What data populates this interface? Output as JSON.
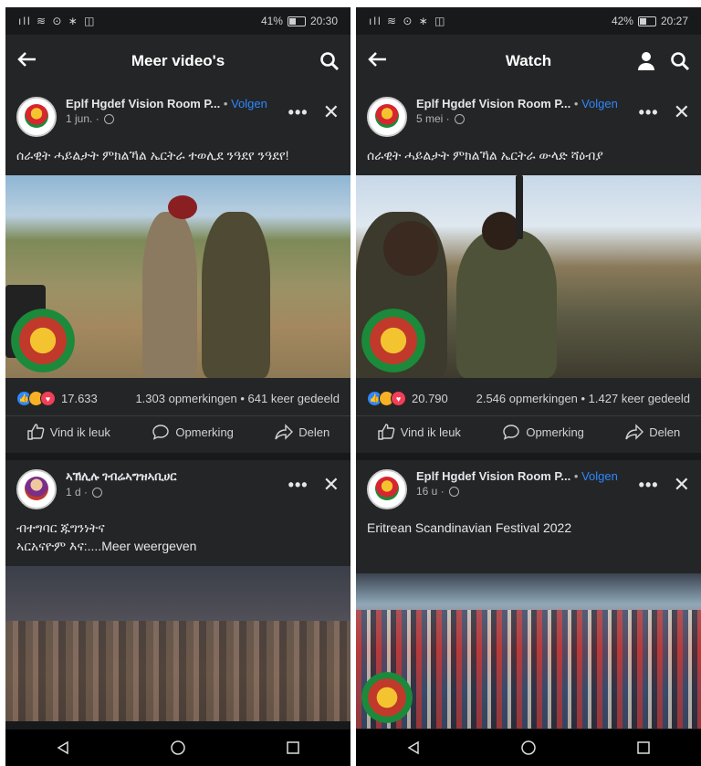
{
  "left": {
    "status": {
      "icons": "ıll ≋ ⊙ ∗ ◫",
      "battery_pct": "41%",
      "time": "20:30"
    },
    "nav": {
      "title": "Meer video's"
    },
    "posts": [
      {
        "author": "Eplf Hgdef Vision Room P...",
        "follow": "Volgen",
        "time": "1 jun.",
        "text": "ሰራዊት ሓይልታት ምክልኻል ኤርትራ ተወሊደ ንዓደየ ንዓደየ!",
        "likes": "17.633",
        "comments_shares": "1.303 opmerkingen • 641 keer gedeeld",
        "like_label": "Vind ik leuk",
        "comment_label": "Opmerking",
        "share_label": "Delen"
      },
      {
        "author": "ኣኽሊሉ ገብሬኣግዝኣቢሀር",
        "time": "1 d",
        "text_line1": "ብተግባር ጁግንነትና",
        "text_line2": "ኣርአናዮም እና:....Meer weergeven"
      }
    ]
  },
  "right": {
    "status": {
      "icons": "ıll ≋ ⊙ ∗ ◫",
      "battery_pct": "42%",
      "time": "20:27"
    },
    "nav": {
      "title": "Watch"
    },
    "posts": [
      {
        "author": "Eplf Hgdef Vision Room P...",
        "follow": "Volgen",
        "time": "5 mei",
        "text": "ሰራዊት ሓይልታት ምክልኻል ኤርትራ ውላድ ሻዕብያ",
        "likes": "20.790",
        "comments_shares": "2.546 opmerkingen • 1.427 keer gedeeld",
        "like_label": "Vind ik leuk",
        "comment_label": "Opmerking",
        "share_label": "Delen"
      },
      {
        "author": "Eplf Hgdef Vision Room P...",
        "follow": "Volgen",
        "time": "16 u",
        "text": "Eritrean Scandinavian Festival 2022"
      }
    ]
  },
  "colors": {
    "background": "#18191a",
    "card": "#242526",
    "accent": "#2d88ff",
    "text": "#e4e6eb",
    "muted": "#b0b3b8"
  },
  "icons": [
    "back-arrow-icon",
    "search-icon",
    "profile-icon",
    "more-icon",
    "close-icon",
    "globe-icon",
    "like-icon",
    "comment-icon",
    "share-icon",
    "back-triangle-icon",
    "home-circle-icon",
    "recents-square-icon"
  ]
}
